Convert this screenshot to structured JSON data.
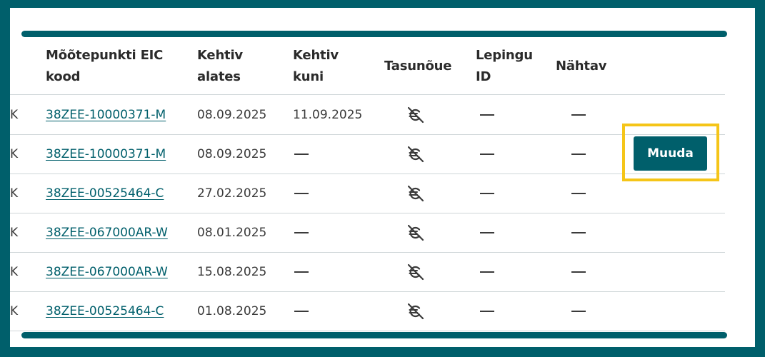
{
  "table": {
    "headers": {
      "eic": [
        "Mõõtepunkti EIC",
        "kood"
      ],
      "valid_from": [
        "Kehtiv",
        "alates"
      ],
      "valid_to": [
        "Kehtiv",
        "kuni"
      ],
      "payment": [
        "Tasunõue"
      ],
      "contract": [
        "Lepingu",
        "ID"
      ],
      "visible": [
        "Nähtav"
      ]
    },
    "rows": [
      {
        "cut": "K",
        "eic": "38ZEE-10000371-M",
        "valid_from": "08.09.2025",
        "valid_to": "11.09.2025",
        "payment_icon": "no-payment-icon",
        "contract": "—",
        "visible": "—"
      },
      {
        "cut": "K",
        "eic": "38ZEE-10000371-M",
        "valid_from": "08.09.2025",
        "valid_to": "—",
        "payment_icon": "no-payment-icon",
        "contract": "—",
        "visible": "—",
        "action": "Muuda"
      },
      {
        "cut": "K",
        "eic": "38ZEE-00525464-C",
        "valid_from": "27.02.2025",
        "valid_to": "—",
        "payment_icon": "no-payment-icon",
        "contract": "—",
        "visible": "—"
      },
      {
        "cut": "K",
        "eic": "38ZEE-067000AR-W",
        "valid_from": "08.01.2025",
        "valid_to": "—",
        "payment_icon": "no-payment-icon",
        "contract": "—",
        "visible": "—"
      },
      {
        "cut": "K",
        "eic": "38ZEE-067000AR-W",
        "valid_from": "15.08.2025",
        "valid_to": "—",
        "payment_icon": "no-payment-icon",
        "contract": "—",
        "visible": "—"
      },
      {
        "cut": "K",
        "eic": "38ZEE-00525464-C",
        "valid_from": "01.08.2025",
        "valid_to": "—",
        "payment_icon": "no-payment-icon",
        "contract": "—",
        "visible": "—"
      }
    ]
  },
  "colors": {
    "frame": "#005f6b",
    "link": "#005f6b",
    "button": "#005f6b",
    "highlight": "#f5c518"
  }
}
